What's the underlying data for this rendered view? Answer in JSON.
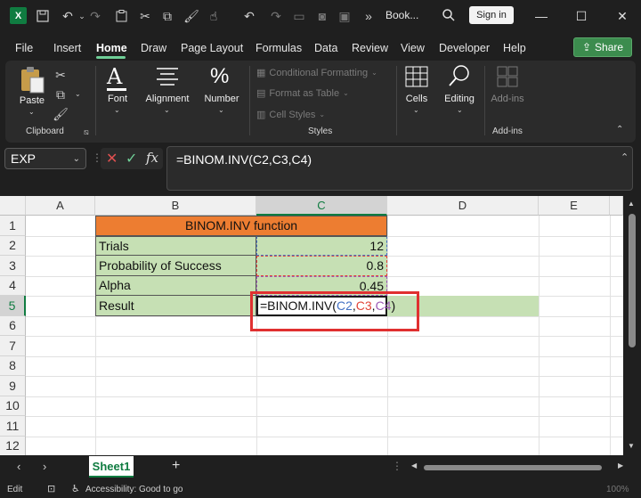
{
  "titlebar": {
    "app_letter": "X",
    "doc_title": "Book...",
    "overflow": "»",
    "signin_label": "Sign in"
  },
  "menu": {
    "tabs": [
      "File",
      "Insert",
      "Home",
      "Draw",
      "Page Layout",
      "Formulas",
      "Data",
      "Review",
      "View",
      "Developer",
      "Help"
    ],
    "active_tab": "Home",
    "share_label": "Share"
  },
  "ribbon": {
    "paste_label": "Paste",
    "clipboard_label": "Clipboard",
    "font_label": "Font",
    "alignment_label": "Alignment",
    "number_label": "Number",
    "conditional_formatting": "Conditional Formatting",
    "format_as_table": "Format as Table",
    "cell_styles": "Cell Styles",
    "styles_label": "Styles",
    "cells_label": "Cells",
    "editing_label": "Editing",
    "addins_label": "Add-ins",
    "addins_group_label": "Add-ins"
  },
  "formula_bar": {
    "name_box": "EXP",
    "fx": "fx",
    "formula": "=BINOM.INV(C2,C3,C4)"
  },
  "columns": [
    "A",
    "B",
    "C",
    "D",
    "E"
  ],
  "rows": [
    "1",
    "2",
    "3",
    "4",
    "5",
    "6",
    "7",
    "8",
    "9",
    "10",
    "11",
    "12"
  ],
  "cells": {
    "title": "BINOM.INV function",
    "b2": "Trials",
    "c2": "12",
    "b3": "Probability of Success",
    "c3": "0.8",
    "b4": "Alpha",
    "c4": "0.45",
    "b5": "Result",
    "c5_prefix": "=BINOM.INV(",
    "c5_ref1": "C2",
    "c5_comma1": ",",
    "c5_ref2": "C3",
    "c5_comma2": ",",
    "c5_ref3": "C4",
    "c5_suffix": ")"
  },
  "colors": {
    "title_fill": "#ed7d31",
    "data_fill": "#c6e0b4",
    "ref1_color": "#4472c4",
    "ref2_color": "#e2463a",
    "ref3_color": "#9b59b6",
    "highlight_box": "#e03030",
    "excel_green": "#107c41"
  },
  "sheets": {
    "active": "Sheet1",
    "add": "+"
  },
  "status": {
    "mode": "Edit",
    "accessibility": "Accessibility: Good to go",
    "zoom": "100%"
  }
}
